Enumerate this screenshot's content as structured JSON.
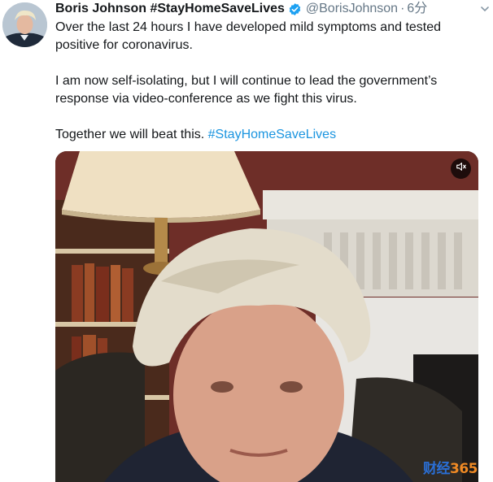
{
  "tweet": {
    "author": {
      "display_name": "Boris Johnson #StayHomeSaveLives",
      "handle": "@BorisJohnson",
      "separator": "·",
      "time": "6分",
      "verified": true
    },
    "paragraphs": [
      {
        "text": "Over the last 24 hours I have developed mild symptoms and tested positive for coronavirus."
      },
      {
        "text": "I am now self-isolating, but I will continue to lead the government’s response via video-conference as we fight this virus."
      },
      {
        "text": "Together we will beat this. ",
        "hashtag": "#StayHomeSaveLives"
      }
    ],
    "media": {
      "type": "video",
      "muted": true,
      "icon": "speaker-muted-icon"
    }
  },
  "watermark": {
    "part1": "财经",
    "part2": "365"
  },
  "colors": {
    "text": "#14171a",
    "secondary": "#657786",
    "link": "#1b95e0",
    "verified_badge": "#1da1f2"
  },
  "icons": {
    "verified": "verified-badge-icon",
    "caret": "chevron-down-icon",
    "mute": "speaker-muted-icon"
  }
}
